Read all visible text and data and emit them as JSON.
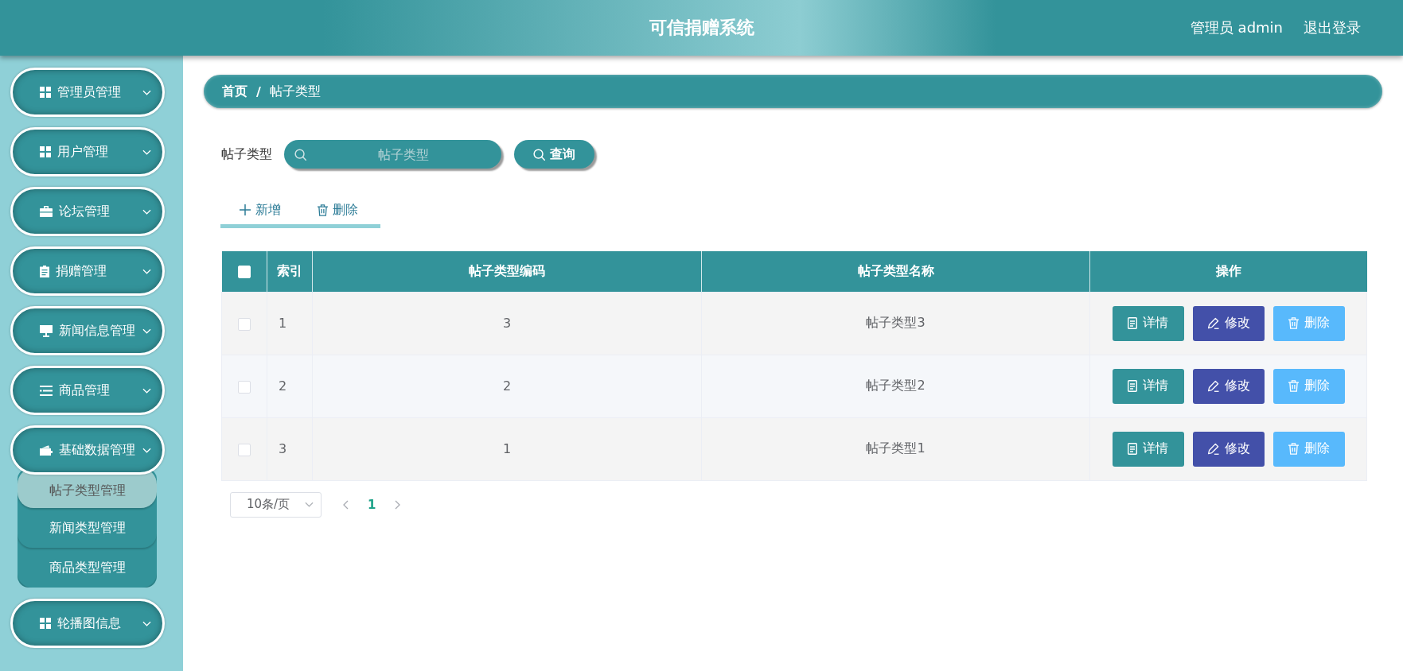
{
  "header": {
    "title": "可信捐赠系统",
    "user": "管理员 admin",
    "logout": "退出登录"
  },
  "sidebar": {
    "items": [
      {
        "label": "管理员管理"
      },
      {
        "label": "用户管理"
      },
      {
        "label": "论坛管理"
      },
      {
        "label": "捐赠管理"
      },
      {
        "label": "新闻信息管理"
      },
      {
        "label": "商品管理"
      },
      {
        "label": "基础数据管理",
        "children": [
          {
            "label": "帖子类型管理",
            "selected": true
          },
          {
            "label": "新闻类型管理",
            "selected": false
          },
          {
            "label": "商品类型管理",
            "selected": false
          }
        ]
      },
      {
        "label": "轮播图信息"
      }
    ]
  },
  "breadcrumb": {
    "items": [
      "首页",
      "帖子类型"
    ],
    "separator": "/"
  },
  "search": {
    "label": "帖子类型",
    "placeholder": "帖子类型",
    "button": "查询"
  },
  "toolbar": [
    {
      "label": "新增",
      "kind": "add"
    },
    {
      "label": "删除",
      "kind": "delete"
    }
  ],
  "table": {
    "select_all": {
      "checked": false
    },
    "columns": [
      "索引",
      "帖子类型编码",
      "帖子类型名称",
      "操作"
    ],
    "rows": [
      {
        "checked": false,
        "cells": [
          "1",
          "3",
          "帖子类型3"
        ],
        "actions": [
          {
            "label": "详情",
            "kind": "detail"
          },
          {
            "label": "修改",
            "kind": "edit"
          },
          {
            "label": "删除",
            "kind": "delete"
          }
        ]
      },
      {
        "checked": false,
        "cells": [
          "2",
          "2",
          "帖子类型2"
        ],
        "actions": [
          {
            "label": "详情",
            "kind": "detail"
          },
          {
            "label": "修改",
            "kind": "edit"
          },
          {
            "label": "删除",
            "kind": "delete"
          }
        ]
      },
      {
        "checked": false,
        "cells": [
          "3",
          "1",
          "帖子类型1"
        ],
        "actions": [
          {
            "label": "详情",
            "kind": "detail"
          },
          {
            "label": "修改",
            "kind": "edit"
          },
          {
            "label": "删除",
            "kind": "delete"
          }
        ]
      }
    ]
  },
  "pagination": {
    "page_size": "10条/页",
    "pages": [
      {
        "label": "1",
        "selected": true
      }
    ]
  }
}
